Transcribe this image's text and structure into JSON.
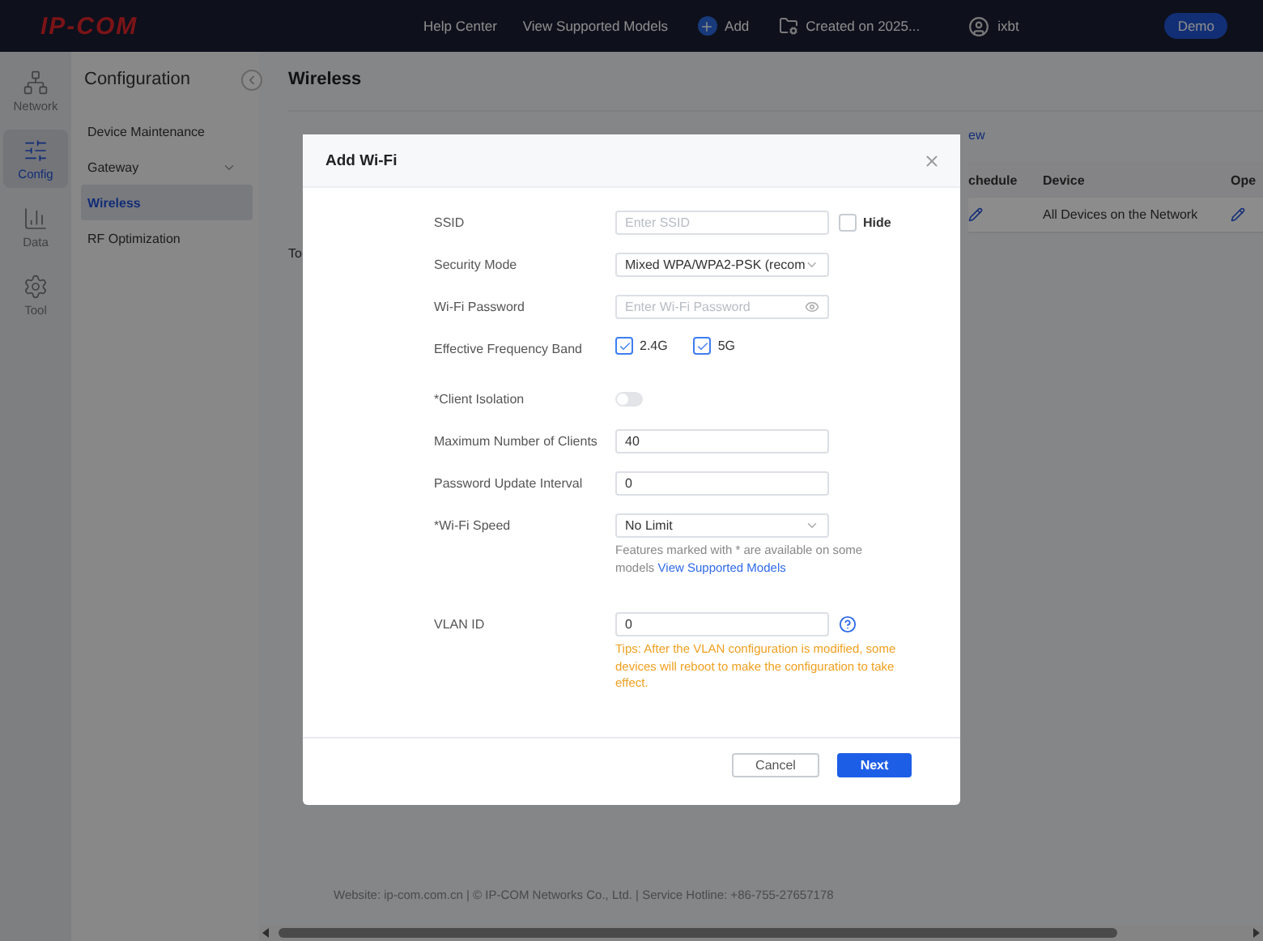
{
  "topbar": {
    "logo": "IP-COM",
    "links": [
      "Help Center",
      "View Supported Models"
    ],
    "add": "Add",
    "created": "Created on 2025...",
    "user": "ixbt",
    "demo": "Demo"
  },
  "rail": [
    {
      "kind": "network",
      "label": "Network",
      "selected": false
    },
    {
      "kind": "config",
      "label": "Config",
      "selected": true
    },
    {
      "kind": "data",
      "label": "Data",
      "selected": false
    },
    {
      "kind": "tool",
      "label": "Tool",
      "selected": false
    }
  ],
  "config_panel": {
    "title": "Configuration",
    "items": [
      {
        "label": "Device Maintenance",
        "selected": false,
        "expandable": false
      },
      {
        "label": "Gateway",
        "selected": false,
        "expandable": true
      },
      {
        "label": "Wireless",
        "selected": true,
        "expandable": false
      },
      {
        "label": "RF Optimization",
        "selected": false,
        "expandable": false
      }
    ]
  },
  "main": {
    "title": "Wireless",
    "link": "ew",
    "columns": [
      "chedule",
      "Device",
      "Ope"
    ],
    "rows": [
      {
        "device": "All Devices on the Network"
      }
    ],
    "total": "To"
  },
  "dialog": {
    "title": "Add Wi-Fi",
    "fields": [
      {
        "kind": "text",
        "label": "SSID",
        "placeholder": "Enter SSID",
        "extra": {
          "label": "Hide",
          "checked": false
        }
      },
      {
        "kind": "select",
        "label": "Security Mode",
        "value": "Mixed WPA/WPA2-PSK (recom"
      },
      {
        "kind": "password",
        "label": "Wi-Fi Password",
        "placeholder": "Enter Wi-Fi Password"
      },
      {
        "kind": "checks",
        "label": "Effective Frequency Band",
        "options": [
          {
            "label": "2.4G",
            "checked": true
          },
          {
            "label": "5G",
            "checked": true
          }
        ]
      },
      {
        "kind": "switch",
        "label": "*Client Isolation",
        "on": false
      },
      {
        "kind": "text",
        "label": "Maximum Number of Clients",
        "value": "40"
      },
      {
        "kind": "text",
        "label": "Password Update Interval",
        "value": "0"
      },
      {
        "kind": "select",
        "label": "*Wi-Fi Speed",
        "value": "No Limit",
        "note": "Features marked with * are available on some models",
        "note_link": "View Supported Models"
      },
      {
        "kind": "text",
        "label": "VLAN ID",
        "value": "0",
        "help": true,
        "tip": "Tips: After the VLAN configuration is modified, some devices will reboot to make the configuration to take effect."
      }
    ],
    "buttons": [
      {
        "label": "Cancel",
        "primary": false
      },
      {
        "label": "Next",
        "primary": true
      }
    ]
  },
  "footer": "Website: ip-com.com.cn | © IP-COM Networks Co., Ltd. | Service Hotline: +86-755-27657178"
}
